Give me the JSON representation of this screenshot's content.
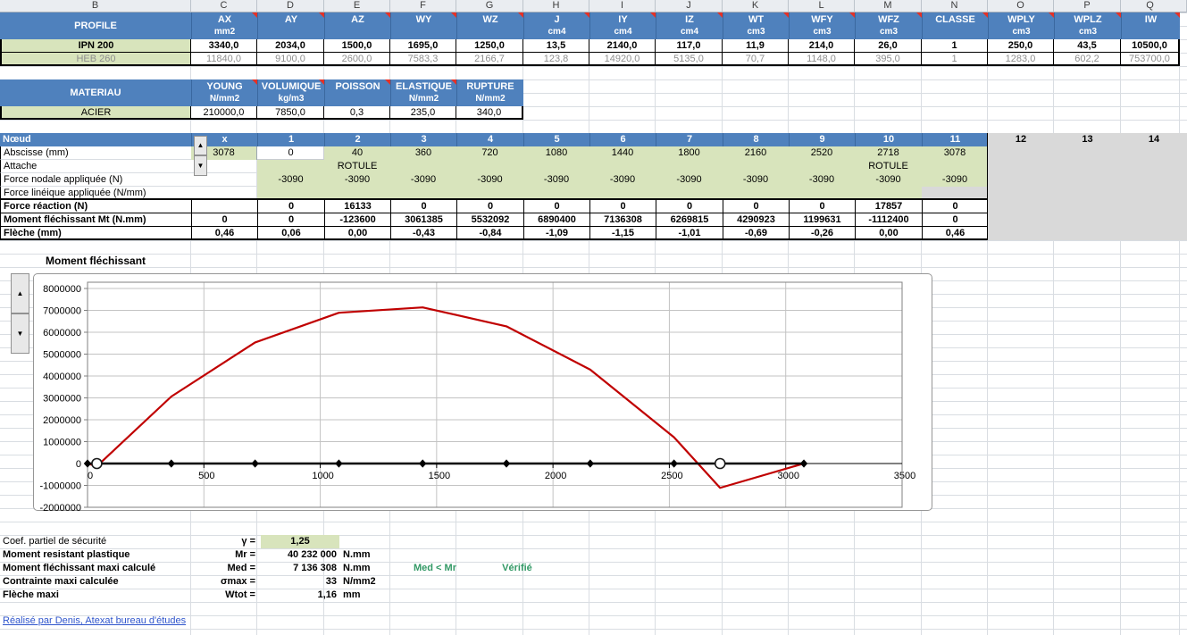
{
  "sheet": {
    "column_letters": [
      "B",
      "C",
      "D",
      "E",
      "F",
      "G",
      "H",
      "I",
      "J",
      "K",
      "L",
      "M",
      "N",
      "O",
      "P",
      "Q"
    ]
  },
  "profile_table": {
    "corner_label": "PROFILE",
    "headers": [
      {
        "label": "AX",
        "unit": "mm2",
        "comment": true
      },
      {
        "label": "AY",
        "unit": "",
        "comment": true
      },
      {
        "label": "AZ",
        "unit": "",
        "comment": true
      },
      {
        "label": "WY",
        "unit": "",
        "comment": true
      },
      {
        "label": "WZ",
        "unit": "",
        "comment": true
      },
      {
        "label": "J",
        "unit": "cm4",
        "comment": true
      },
      {
        "label": "IY",
        "unit": "cm4",
        "comment": true
      },
      {
        "label": "IZ",
        "unit": "cm4",
        "comment": true
      },
      {
        "label": "WT",
        "unit": "cm3",
        "comment": true
      },
      {
        "label": "WFY",
        "unit": "cm3",
        "comment": true
      },
      {
        "label": "WFZ",
        "unit": "cm3",
        "comment": true
      },
      {
        "label": "CLASSE",
        "unit": "",
        "comment": true
      },
      {
        "label": "WPLY",
        "unit": "cm3",
        "comment": true
      },
      {
        "label": "WPLZ",
        "unit": "cm3",
        "comment": true
      },
      {
        "label": "IW",
        "unit": "",
        "comment": true
      }
    ],
    "rows": [
      {
        "name": "IPN 200",
        "active": true,
        "values": [
          "3340,0",
          "2034,0",
          "1500,0",
          "1695,0",
          "1250,0",
          "13,5",
          "2140,0",
          "117,0",
          "11,9",
          "214,0",
          "26,0",
          "1",
          "250,0",
          "43,5",
          "10500,0"
        ]
      },
      {
        "name": "HEB 260",
        "active": false,
        "values": [
          "11840,0",
          "9100,0",
          "2600,0",
          "7583,3",
          "2166,7",
          "123,8",
          "14920,0",
          "5135,0",
          "70,7",
          "1148,0",
          "395,0",
          "1",
          "1283,0",
          "602,2",
          "753700,0"
        ]
      }
    ]
  },
  "material_table": {
    "corner_label": "MATERIAU",
    "headers": [
      {
        "label": "YOUNG",
        "unit": "N/mm2",
        "comment": true
      },
      {
        "label": "VOLUMIQUE",
        "unit": "kg/m3",
        "comment": true
      },
      {
        "label": "POISSON",
        "unit": "",
        "comment": true
      },
      {
        "label": "ELASTIQUE",
        "unit": "N/mm2",
        "comment": true
      },
      {
        "label": "RUPTURE",
        "unit": "N/mm2",
        "comment": false
      }
    ],
    "rows": [
      {
        "name": "ACIER",
        "values": [
          "210000,0",
          "7850,0",
          "0,3",
          "235,0",
          "340,0"
        ]
      }
    ]
  },
  "node_table": {
    "title": "Nœud",
    "x_column": {
      "header": "x",
      "abscisse": "3078",
      "attache": "",
      "force_nodale": "",
      "force_lineique": "",
      "reaction": "",
      "moment": "0",
      "fleche": "0,46"
    },
    "row_labels": {
      "abscisse": "Abscisse (mm)",
      "attache": "Attache",
      "force_nodale": "Force nodale appliquée (N)",
      "force_lineique": "Force linéique appliquée (N/mm)",
      "reaction": "Force réaction (N)",
      "moment": "Moment fléchissant Mt (N.mm)",
      "fleche": "Flèche (mm)"
    },
    "node_numbers": [
      "1",
      "2",
      "3",
      "4",
      "5",
      "6",
      "7",
      "8",
      "9",
      "10",
      "11"
    ],
    "abscisse": [
      "0",
      "40",
      "360",
      "720",
      "1080",
      "1440",
      "1800",
      "2160",
      "2520",
      "2718",
      "3078"
    ],
    "attache": [
      "",
      "ROTULE",
      "",
      "",
      "",
      "",
      "",
      "",
      "",
      "ROTULE",
      ""
    ],
    "force_nodale": [
      "-3090",
      "-3090",
      "-3090",
      "-3090",
      "-3090",
      "-3090",
      "-3090",
      "-3090",
      "-3090",
      "-3090",
      "-3090"
    ],
    "force_lineique": [
      "",
      "",
      "",
      "",
      "",
      "",
      "",
      "",
      "",
      "",
      ""
    ],
    "reaction": [
      "0",
      "16133",
      "0",
      "0",
      "0",
      "0",
      "0",
      "0",
      "0",
      "17857",
      "0"
    ],
    "moment": [
      "0",
      "-123600",
      "3061385",
      "5532092",
      "6890400",
      "7136308",
      "6269815",
      "4290923",
      "1199631",
      "-1112400",
      "0"
    ],
    "fleche": [
      "0,06",
      "0,00",
      "-0,43",
      "-0,84",
      "-1,09",
      "-1,15",
      "-1,01",
      "-0,69",
      "-0,26",
      "0,00",
      "0,46"
    ],
    "ghost_nodes": [
      "12",
      "13",
      "14"
    ]
  },
  "chart": {
    "title": "Moment fléchissant"
  },
  "chart_data": {
    "type": "line",
    "title": "Moment fléchissant",
    "xlabel": "",
    "ylabel": "",
    "xlim": [
      0,
      3500
    ],
    "ylim": [
      -2000000,
      8000000
    ],
    "x_ticks": [
      0,
      500,
      1000,
      1500,
      2000,
      2500,
      3000,
      3500
    ],
    "y_ticks": [
      8000000,
      7000000,
      6000000,
      5000000,
      4000000,
      3000000,
      2000000,
      1000000,
      0,
      -1000000,
      -2000000
    ],
    "grid": true,
    "legend": "none",
    "series": [
      {
        "name": "moment-flechissant",
        "color": "#c00000",
        "x": [
          0,
          40,
          360,
          720,
          1080,
          1440,
          1800,
          2160,
          2520,
          2718,
          3078
        ],
        "y": [
          0,
          -123600,
          3061385,
          5532092,
          6890400,
          7136308,
          6269815,
          4290923,
          1199631,
          -1112400,
          0
        ]
      },
      {
        "name": "poutre-noeuds",
        "color": "#000000",
        "marker": "diamond",
        "x": [
          0,
          40,
          360,
          720,
          1080,
          1440,
          1800,
          2160,
          2520,
          2718,
          3078
        ],
        "y": [
          0,
          0,
          0,
          0,
          0,
          0,
          0,
          0,
          0,
          0,
          0
        ],
        "rotule_x": [
          40,
          2718
        ]
      }
    ]
  },
  "summary": {
    "rows": [
      {
        "id": "gamma",
        "label": "Coef. partiel de sécurité",
        "symbol": "γ =",
        "value": "1,25",
        "unit": "",
        "highlight": true,
        "bold_label": false
      },
      {
        "id": "mr",
        "label": "Moment resistant plastique",
        "symbol": "Mr =",
        "value": "40 232 000",
        "unit": "N.mm",
        "highlight": false,
        "bold_label": true
      },
      {
        "id": "med",
        "label": "Moment fléchissant maxi calculé",
        "symbol": "Med =",
        "value": "7 136 308",
        "unit": "N.mm",
        "highlight": false,
        "bold_label": true
      },
      {
        "id": "sigma",
        "label": "Contrainte maxi calculée",
        "symbol": "σmax =",
        "value": "33",
        "unit": "N/mm2",
        "highlight": false,
        "bold_label": true
      },
      {
        "id": "wtot",
        "label": "Flèche maxi",
        "symbol": "Wtot =",
        "value": "1,16",
        "unit": "mm",
        "highlight": false,
        "bold_label": true
      }
    ],
    "check_text": "Med < Mr",
    "status_text": "Vérifié",
    "status_color": "#339966"
  },
  "footer": {
    "link_text": "Réalisé par Denis, Atexat bureau d'études"
  },
  "colors": {
    "header_blue": "#4f81bd",
    "green_cell": "#d8e4bc",
    "gray_area": "#d9d9d9",
    "chart_line_red": "#c00000",
    "status_green": "#339966",
    "link_blue": "#2f55cc"
  }
}
